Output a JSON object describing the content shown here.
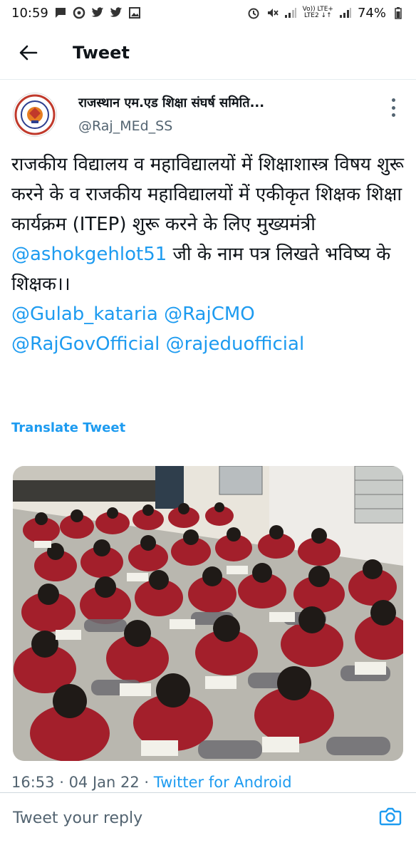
{
  "status_bar": {
    "time": "10:59",
    "lte_top": "Vo)) LTE+",
    "lte_bottom": "LTE2 ↓↑",
    "battery": "74%"
  },
  "header": {
    "title": "Tweet"
  },
  "author": {
    "display_name": "राजस्थान एम.एड शिक्षा संघर्ष समिति...",
    "handle": "@Raj_MEd_SS"
  },
  "tweet": {
    "text_part1": "राजकीय विद्यालय व महाविद्यालयों में शिक्षाशास्त्र विषय शुरू करने के व राजकीय महाविद्यालयों में एकीकृत शिक्षक शिक्षा कार्यक्रम (ITEP) शुरू करने के लिए मुख्यमंत्री ",
    "mention1": "@ashokgehlot51",
    "text_part2": " जी के नाम पत्र लिखते भविष्य के शिक्षक।।",
    "mentions": [
      "@Gulab_kataria",
      "@RajCMO",
      "@RajGovOfficial",
      "@rajeduofficial"
    ],
    "translate_label": "Translate Tweet"
  },
  "meta": {
    "time": "16:53",
    "date": "04 Jan 22",
    "source": "Twitter for Android"
  },
  "reply": {
    "placeholder": "Tweet your reply"
  },
  "colors": {
    "accent": "#1d9bf0",
    "secondary_text": "#536471",
    "uniform": "#b4202c"
  }
}
